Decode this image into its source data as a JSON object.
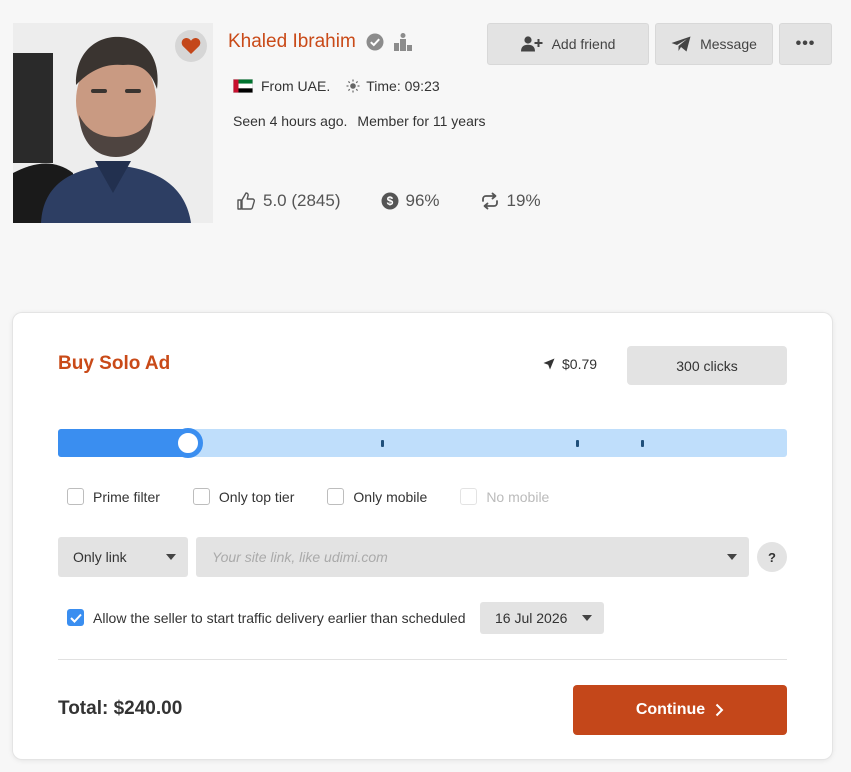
{
  "profile": {
    "name": "Khaled Ibrahim",
    "from": "From UAE.",
    "time": "Time: 09:23",
    "seen": "Seen 4 hours ago.",
    "member": "Member for 11 years",
    "rating": "5.0 (2845)",
    "sales_percent": "96%",
    "repeat_percent": "19%",
    "icons": [
      "heart-icon",
      "verified-badge-icon",
      "ranking-podium-icon",
      "uae-flag-icon",
      "sun-icon",
      "thumbs-up-icon",
      "dollar-circle-icon",
      "repeat-icon"
    ]
  },
  "header_buttons": {
    "add_friend": "Add friend",
    "message": "Message",
    "more": "•••"
  },
  "solo_ad": {
    "title": "Buy Solo Ad",
    "price_per_click": "$0.79",
    "clicks_label": "300 clicks",
    "slider_level_fraction": 0.178,
    "slider_tick_fractions": [
      0.445,
      0.712,
      0.801
    ],
    "options": [
      {
        "label": "Prime filter",
        "checked": false,
        "disabled": false
      },
      {
        "label": "Only top tier",
        "checked": false,
        "disabled": false
      },
      {
        "label": "Only mobile",
        "checked": false,
        "disabled": false
      },
      {
        "label": "No mobile",
        "checked": false,
        "disabled": true
      }
    ],
    "link_type": "Only link",
    "url_placeholder": "Your site link, like udimi.com",
    "url_value": "",
    "help_label": "?",
    "allow_early_label": "Allow the seller to start traffic delivery earlier than scheduled",
    "allow_early_checked": true,
    "date": "16 Jul 2026",
    "total": "Total: $240.00",
    "continue_label": "Continue"
  },
  "colors": {
    "brand": "#c4471a",
    "accent_blue": "#3a8ef0",
    "slider_track": "#bfdefb"
  }
}
